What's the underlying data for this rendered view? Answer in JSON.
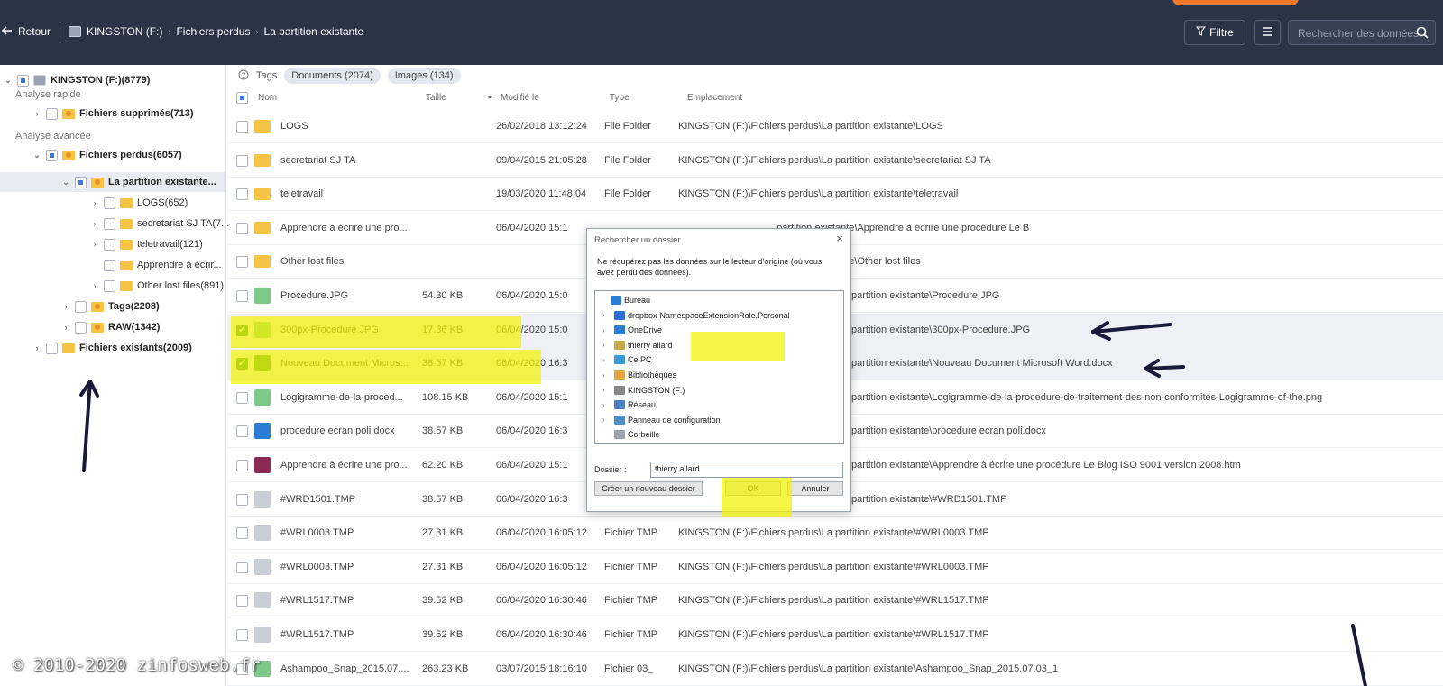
{
  "topbar": {
    "back_label": "Retour",
    "breadcrumb": [
      "KINGSTON (F:)",
      "Fichiers perdus",
      "La partition existante"
    ],
    "filter_label": "Filtre",
    "search_placeholder": "Rechercher des données"
  },
  "sidebar": {
    "root": "KINGSTON (F:)(8779)",
    "quick_scan_label": "Analyse rapide",
    "deleted": "Fichiers supprimés(713)",
    "advanced_scan_label": "Analyse avancée",
    "lost": "Fichiers perdus(6057)",
    "partition": "La partition existante...",
    "children": [
      "LOGS(652)",
      "secretariat SJ TA(7...",
      "teletravail(121)",
      "Apprendre à écrir...",
      "Other lost files(891)"
    ],
    "tags": "Tags(2208)",
    "raw": "RAW(1342)",
    "existing": "Fichiers existants(2009)"
  },
  "main": {
    "tags_label": "Tags",
    "tag_chips": [
      "Documents (2074)",
      "Images (134)"
    ],
    "columns": {
      "name": "Nom",
      "size": "Taille",
      "modified": "Modifié le",
      "type": "Type",
      "location": "Emplacement"
    },
    "rows": [
      {
        "name": "LOGS",
        "size": "",
        "date": "26/02/2018 13:12:24",
        "type": "File Folder",
        "loc": "KINGSTON (F:)\\Fichiers perdus\\La partition existante\\LOGS",
        "icon": "folder",
        "checked": false
      },
      {
        "name": "secretariat SJ TA",
        "size": "",
        "date": "09/04/2015 21:05:28",
        "type": "File Folder",
        "loc": "KINGSTON (F:)\\Fichiers perdus\\La partition existante\\secretariat SJ TA",
        "icon": "folder",
        "checked": false
      },
      {
        "name": "teletravail",
        "size": "",
        "date": "19/03/2020 11:48:04",
        "type": "File Folder",
        "loc": "KINGSTON (F:)\\Fichiers perdus\\La partition existante\\teletravail",
        "icon": "folder",
        "checked": false
      },
      {
        "name": "Apprendre à écrire une pro...",
        "size": "",
        "date": "06/04/2020 15:1",
        "type": "",
        "loc": "...partition existante\\Apprendre à écrire une procédure   Le B",
        "icon": "folder",
        "checked": false
      },
      {
        "name": "Other lost files",
        "size": "",
        "date": "",
        "type": "",
        "loc": "...partition existante\\Other lost files",
        "icon": "folder",
        "checked": false
      },
      {
        "name": "Procedure.JPG",
        "size": "54.30 KB",
        "date": "06/04/2020 15:0",
        "type": "",
        "loc": "partition existante\\Procedure.JPG",
        "icon": "img",
        "checked": false
      },
      {
        "name": "300px-Procedure.JPG",
        "size": "17.86 KB",
        "date": "06/04/2020 15:0",
        "type": "",
        "loc": "partition existante\\300px-Procedure.JPG",
        "icon": "img",
        "checked": true
      },
      {
        "name": "Nouveau Document Micros...",
        "size": "38.57 KB",
        "date": "06/04/2020 16:3",
        "type": "",
        "loc": "partition existante\\Nouveau Document Microsoft Word.docx",
        "icon": "wordg",
        "checked": true
      },
      {
        "name": "Logigramme-de-la-proced...",
        "size": "108.15 KB",
        "date": "06/04/2020 15:1",
        "type": "",
        "loc": "partition existante\\Logigramme-de-la-procedure-de-traitement-des-non-conformites-Logigramme-of-the.png",
        "icon": "img",
        "checked": false
      },
      {
        "name": "procedure ecran poli.docx",
        "size": "38.57 KB",
        "date": "06/04/2020 16:3",
        "type": "",
        "loc": "partition existante\\procedure ecran poli.docx",
        "icon": "word",
        "checked": false
      },
      {
        "name": "Apprendre à écrire une pro...",
        "size": "62.20 KB",
        "date": "06/04/2020 15:1",
        "type": "",
        "loc": "partition existante\\Apprendre à écrire une procédure   Le Blog ISO 9001 version 2008.htm",
        "icon": "htm",
        "checked": false
      },
      {
        "name": "#WRD1501.TMP",
        "size": "38.57 KB",
        "date": "06/04/2020 16:3",
        "type": "",
        "loc": "partition existante\\#WRD1501.TMP",
        "icon": "tmp",
        "checked": false
      },
      {
        "name": "#WRL0003.TMP",
        "size": "27.31 KB",
        "date": "06/04/2020 16:05:12",
        "type": "Fichier TMP",
        "loc": "KINGSTON (F:)\\Fichiers perdus\\La partition existante\\#WRL0003.TMP",
        "icon": "tmp",
        "checked": false
      },
      {
        "name": "#WRL0003.TMP",
        "size": "27.31 KB",
        "date": "06/04/2020 16:05:12",
        "type": "Fichier TMP",
        "loc": "KINGSTON (F:)\\Fichiers perdus\\La partition existante\\#WRL0003.TMP",
        "icon": "tmp",
        "checked": false
      },
      {
        "name": "#WRL1517.TMP",
        "size": "39.52 KB",
        "date": "06/04/2020 16:30:46",
        "type": "Fichier TMP",
        "loc": "KINGSTON (F:)\\Fichiers perdus\\La partition existante\\#WRL1517.TMP",
        "icon": "tmp",
        "checked": false
      },
      {
        "name": "#WRL1517.TMP",
        "size": "39.52 KB",
        "date": "06/04/2020 16:30:46",
        "type": "Fichier TMP",
        "loc": "KINGSTON (F:)\\Fichiers perdus\\La partition existante\\#WRL1517.TMP",
        "icon": "tmp",
        "checked": false
      },
      {
        "name": "Ashampoo_Snap_2015.07....",
        "size": "263.23 KB",
        "date": "03/07/2015 18:16:10",
        "type": "Fichier 03_",
        "loc": "KINGSTON (F:)\\Fichiers perdus\\La partition existante\\Ashampoo_Snap_2015.07.03_1",
        "icon": "img",
        "checked": false
      }
    ]
  },
  "dialog": {
    "title": "Rechercher un dossier",
    "message": "Ne récupérez pas les données sur le lecteur d'origine (où vous avez perdu des données).",
    "tree": [
      {
        "label": "Bureau",
        "icon": "#2b7cd3",
        "chevron": false,
        "indent": 0
      },
      {
        "label": "dropbox-NamespaceExtensionRole.Personal",
        "icon": "#2b6fe0",
        "chevron": true,
        "indent": 1
      },
      {
        "label": "OneDrive",
        "icon": "#2b7cd3",
        "chevron": true,
        "indent": 1
      },
      {
        "label": "thierry allard",
        "icon": "#c9a74a",
        "chevron": true,
        "indent": 1
      },
      {
        "label": "Ce PC",
        "icon": "#3a9ad8",
        "chevron": true,
        "indent": 1
      },
      {
        "label": "Bibliothèques",
        "icon": "#e8a33a",
        "chevron": true,
        "indent": 1
      },
      {
        "label": "KINGSTON (F:)",
        "icon": "#888888",
        "chevron": true,
        "indent": 1
      },
      {
        "label": "Réseau",
        "icon": "#4a7fc8",
        "chevron": true,
        "indent": 1
      },
      {
        "label": "Panneau de configuration",
        "icon": "#4a8fc8",
        "chevron": true,
        "indent": 1
      },
      {
        "label": "Corbeille",
        "icon": "#9aa3b0",
        "chevron": false,
        "indent": 1
      }
    ],
    "folder_label": "Dossier :",
    "folder_value": "thierry allard",
    "new_folder_button": "Créer un nouveau dossier",
    "ok_button": "OK",
    "cancel_button": "Annuler"
  },
  "watermark": "© 2010-2020 zinfosweb.fr",
  "colors": {
    "topbar": "#2b3447",
    "highlight": "#f2f200",
    "accent": "#3b7be6",
    "arrow": "#1a1a3a"
  }
}
